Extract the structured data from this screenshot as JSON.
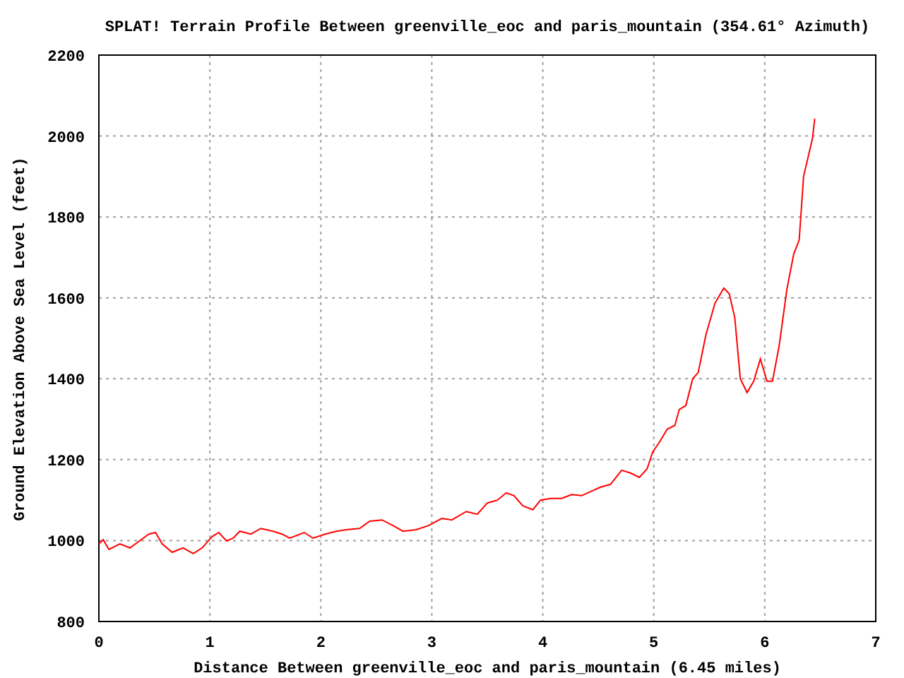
{
  "chart_data": {
    "type": "line",
    "title": "SPLAT! Terrain Profile Between greenville_eoc and paris_mountain (354.61° Azimuth)",
    "xlabel": "Distance Between greenville_eoc and paris_mountain (6.45 miles)",
    "ylabel": "Ground Elevation Above Sea Level (feet)",
    "x": [
      0,
      0.04,
      0.09,
      0.19,
      0.28,
      0.38,
      0.45,
      0.51,
      0.57,
      0.66,
      0.76,
      0.85,
      0.93,
      1.02,
      1.08,
      1.15,
      1.21,
      1.27,
      1.37,
      1.46,
      1.57,
      1.65,
      1.72,
      1.85,
      1.93,
      2.04,
      2.14,
      2.23,
      2.35,
      2.44,
      2.55,
      2.65,
      2.74,
      2.86,
      2.97,
      3.09,
      3.18,
      3.31,
      3.41,
      3.5,
      3.59,
      3.67,
      3.74,
      3.82,
      3.91,
      3.98,
      4.07,
      4.17,
      4.26,
      4.35,
      4.43,
      4.52,
      4.61,
      4.71,
      4.79,
      4.87,
      4.94,
      4.99,
      5.05,
      5.12,
      5.19,
      5.23,
      5.29,
      5.35,
      5.4,
      5.47,
      5.55,
      5.63,
      5.68,
      5.73,
      5.78,
      5.84,
      5.9,
      5.96,
      6.02,
      6.07,
      6.13,
      6.2,
      6.26,
      6.31,
      6.35,
      6.43,
      6.45
    ],
    "grid": true,
    "series": [
      {
        "color": "#ff0000",
        "values": [
          992,
          1002,
          978,
          992,
          982,
          1002,
          1016,
          1020,
          992,
          971,
          982,
          968,
          982,
          1010,
          1020,
          999,
          1006,
          1023,
          1016,
          1030,
          1023,
          1016,
          1006,
          1020,
          1006,
          1016,
          1023,
          1027,
          1030,
          1048,
          1051,
          1037,
          1023,
          1027,
          1037,
          1055,
          1051,
          1072,
          1065,
          1093,
          1100,
          1118,
          1111,
          1086,
          1076,
          1100,
          1104,
          1104,
          1114,
          1111,
          1121,
          1132,
          1139,
          1174,
          1167,
          1156,
          1177,
          1219,
          1243,
          1275,
          1285,
          1324,
          1334,
          1400,
          1415,
          1509,
          1586,
          1624,
          1610,
          1551,
          1400,
          1366,
          1394,
          1449,
          1394,
          1394,
          1481,
          1621,
          1708,
          1743,
          1900,
          1994,
          2043
        ]
      }
    ],
    "xlim": [
      0,
      7
    ],
    "ylim": [
      800,
      2200
    ],
    "xticks": [
      0,
      1,
      2,
      3,
      4,
      5,
      6,
      7
    ],
    "yticks": [
      800,
      1000,
      1200,
      1400,
      1600,
      1800,
      2000,
      2200
    ]
  }
}
